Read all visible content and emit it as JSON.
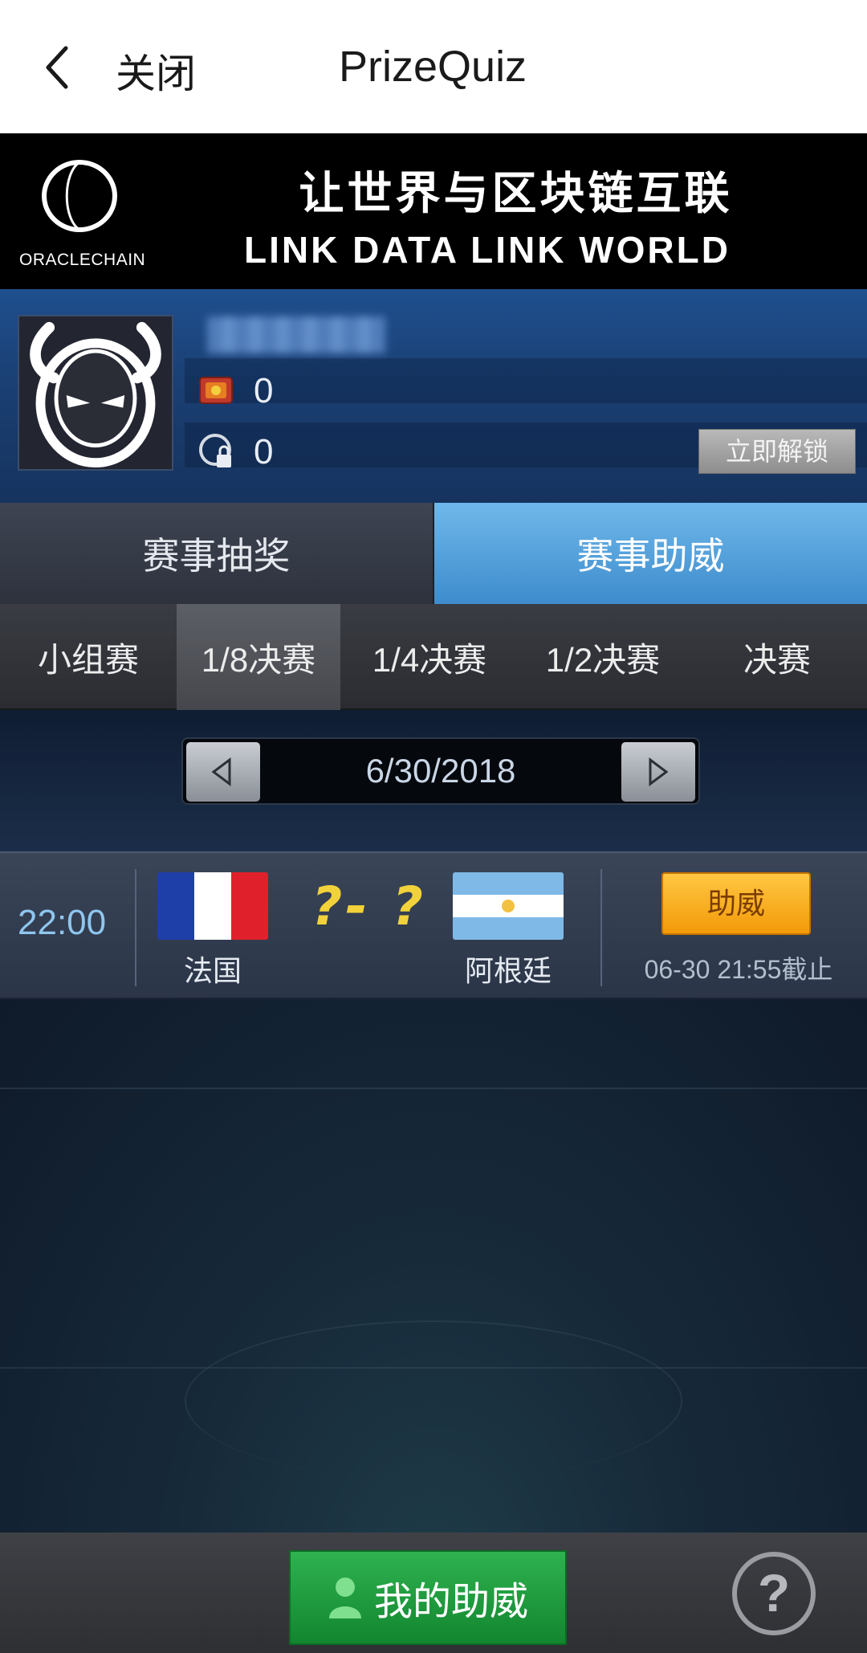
{
  "topbar": {
    "back_icon": "chevron-left-icon",
    "close_label": "关闭",
    "title": "PrizeQuiz"
  },
  "banner": {
    "logo_text": "ORACLECHAIN",
    "slogan_cn": "让世界与区块链互联",
    "slogan_en": "LINK DATA LINK WORLD"
  },
  "profile": {
    "ticket_count": "0",
    "lock_count": "0",
    "unlock_label": "立即解锁"
  },
  "main_tabs": [
    {
      "label": "赛事抽奖",
      "active": false
    },
    {
      "label": "赛事助威",
      "active": true
    }
  ],
  "stage_tabs": [
    {
      "label": "小组赛",
      "active": false
    },
    {
      "label": "1/8决赛",
      "active": true
    },
    {
      "label": "1/4决赛",
      "active": false
    },
    {
      "label": "1/2决赛",
      "active": false
    },
    {
      "label": "决赛",
      "active": false
    }
  ],
  "date_selector": {
    "date": "6/30/2018",
    "prev_icon": "triangle-left-icon",
    "next_icon": "triangle-right-icon"
  },
  "match": {
    "time": "22:00",
    "home_team": "法国",
    "away_team": "阿根廷",
    "score": "?- ?",
    "cheer_label": "助威",
    "deadline": "06-30 21:55截止"
  },
  "bottom": {
    "my_cheer_label": "我的助威",
    "help_symbol": "?"
  },
  "colors": {
    "active_tab": "#4a9ad8",
    "cheer_button": "#f6a91c",
    "my_cheer_button": "#1f9a3e",
    "score": "#f2d23a"
  }
}
